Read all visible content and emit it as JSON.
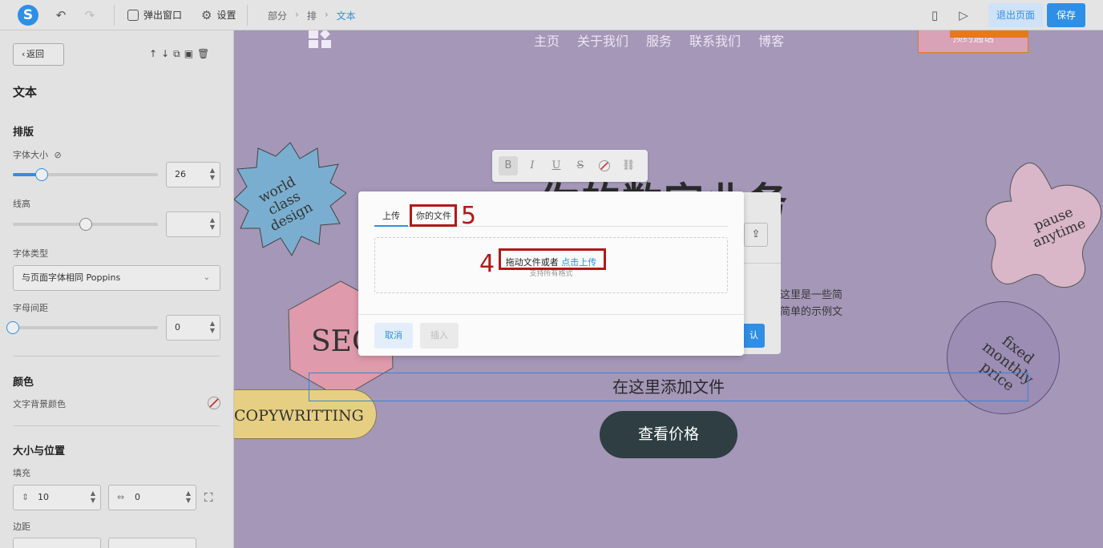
{
  "topbar": {
    "logo_letter": "S",
    "popup_label": "弹出窗口",
    "settings_label": "设置",
    "breadcrumbs": [
      "部分",
      "排",
      "文本"
    ],
    "exit_label": "退出页面",
    "save_label": "保存"
  },
  "left_panel": {
    "back_label": "返回",
    "title": "文本",
    "typography_heading": "排版",
    "font_size_label": "字体大小",
    "font_size_value": "26",
    "font_size_slider": 0.2,
    "line_height_label": "线高",
    "line_height_value": "",
    "line_height_slider": 0.5,
    "font_type_label": "字体类型",
    "font_type_value": "与页面字体相同 Poppins",
    "letter_spacing_label": "字母间距",
    "letter_spacing_value": "0",
    "letter_spacing_slider": 0.0,
    "color_heading": "颜色",
    "text_bg_color_label": "文字背景颜色",
    "size_position_heading": "大小与位置",
    "padding_label": "填充",
    "padding_vertical": "10",
    "padding_horizontal": "0",
    "margin_label": "边距"
  },
  "canvas": {
    "nav_items": [
      "主页",
      "关于我们",
      "服务",
      "联系我们",
      "博客"
    ],
    "hero_title": "你的数字业务",
    "body_line1": "息这里是一些简",
    "body_line2": "些简单的示例文",
    "shape_world": "world class design",
    "shape_pause": "pause anytime",
    "shape_seo": "SEO",
    "shape_copy": "COPYWRITTING",
    "shape_fixed": "fixed monthly price",
    "selected_text": "在这里添加文件",
    "price_button": "查看价格",
    "orange_button_text": "预约通话",
    "confirm_peek": "认"
  },
  "dialog": {
    "tab_upload": "上传",
    "tab_your_files": "你的文件",
    "drop_text": "拖动文件或者 ",
    "drop_link": "点击上传",
    "drop_sub": "支持所有格式",
    "cancel_label": "取消",
    "insert_label": "插入"
  },
  "annotations": {
    "label_4": "4",
    "label_5": "5",
    "color": "#b01919"
  },
  "colors": {
    "accent": "#2f8fe6",
    "canvas_bg": "#a497b8",
    "price_button_bg": "#2e3e42"
  }
}
